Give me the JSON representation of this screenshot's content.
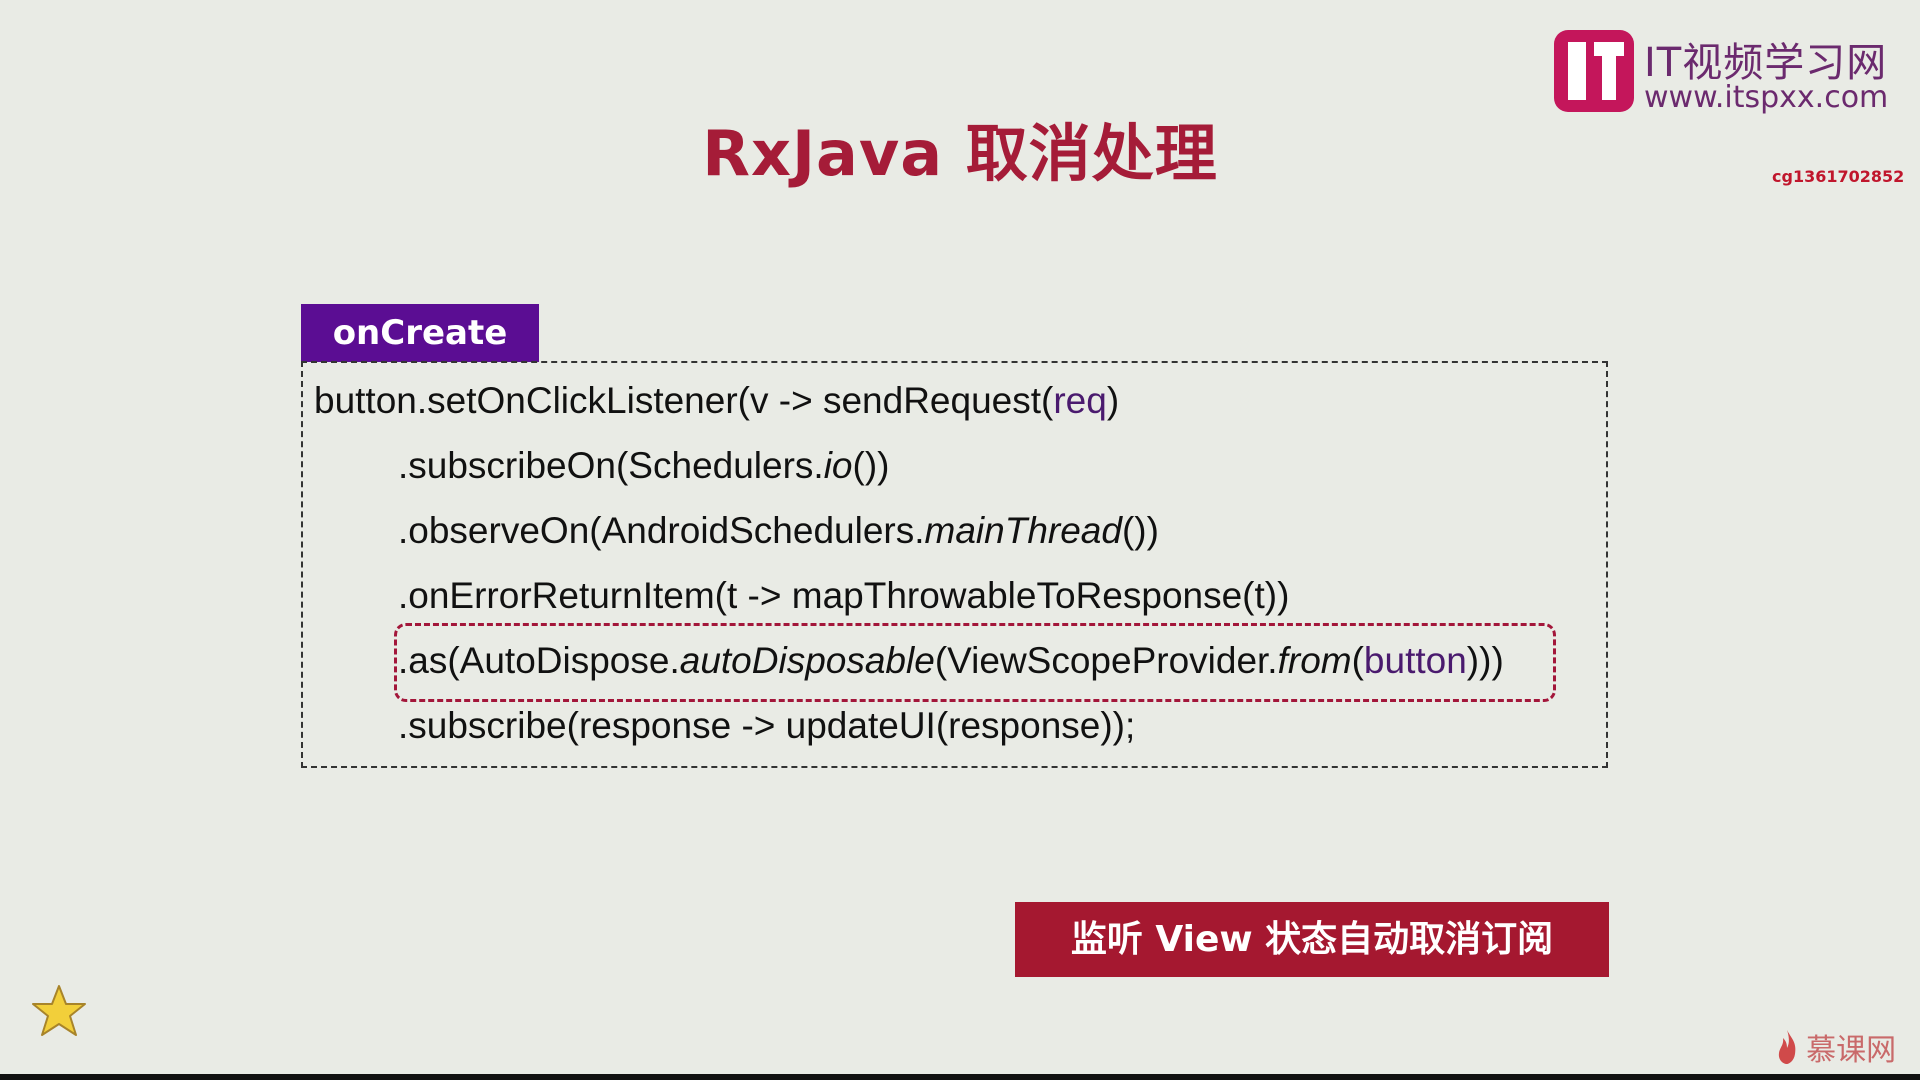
{
  "slide": {
    "title": "RxJava 取消处理",
    "logo": {
      "cn_text": "IT视频学习网",
      "url": "www.itspxx.com"
    },
    "watermark_id": "cg1361702852",
    "tag_label": "onCreate",
    "code": {
      "line1": {
        "a": "button.setOnClickListener(v -> sendRequest(",
        "b": "req",
        "c": ")"
      },
      "line2": {
        "a": ".subscribeOn(Schedulers.",
        "b": "io",
        "c": "())"
      },
      "line3": {
        "a": ".observeOn(AndroidSchedulers.",
        "b": "mainThread",
        "c": "())"
      },
      "line4": {
        "a": ".onErrorReturnItem(t -> mapThrowableToResponse(t))"
      },
      "line5": {
        "a": ".as(AutoDispose.",
        "b": "autoDisposable",
        "c": "(ViewScopeProvider.",
        "d": "from",
        "e": "(",
        "f": "button",
        "g": ")))"
      },
      "line6": {
        "a": ".subscribe(response -> updateUI(response));"
      }
    },
    "note": "监听 View 状态自动取消订阅",
    "footer_brand": "慕课网"
  },
  "colors": {
    "title": "#a51c38",
    "tag_bg": "#5b0d93",
    "note_bg": "#a51830",
    "highlight_border": "#a3163a",
    "background": "#e9ebe5"
  },
  "icons": {
    "logo": "itspxx-logo-icon",
    "star": "star-icon",
    "flame": "flame-icon"
  }
}
